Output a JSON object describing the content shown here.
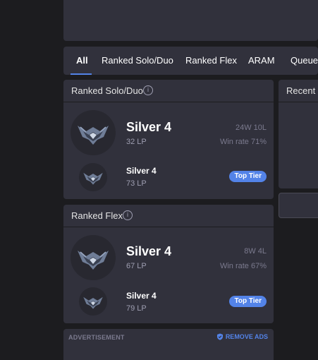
{
  "tabs": [
    {
      "label": "All",
      "active": true
    },
    {
      "label": "Ranked Solo/Duo",
      "active": false
    },
    {
      "label": "Ranked Flex",
      "active": false
    },
    {
      "label": "ARAM",
      "active": false
    },
    {
      "label": "Queue",
      "active": false
    }
  ],
  "solo": {
    "title": "Ranked Solo/Duo",
    "info_icon": "i",
    "current": {
      "tier": "Silver 4",
      "lp": "32 LP",
      "record": "24W 10L",
      "win_rate": "Win rate 71%"
    },
    "top": {
      "tier": "Silver 4",
      "lp": "73 LP",
      "badge": "Top Tier"
    }
  },
  "flex": {
    "title": "Ranked Flex",
    "info_icon": "i",
    "current": {
      "tier": "Silver 4",
      "lp": "67 LP",
      "record": "8W 4L",
      "win_rate": "Win rate 67%"
    },
    "top": {
      "tier": "Silver 4",
      "lp": "79 LP",
      "badge": "Top Tier"
    }
  },
  "recent": {
    "title": "Recent G"
  },
  "ad": {
    "label": "ADVERTISEMENT",
    "remove": "REMOVE ADS"
  },
  "icons": {
    "rank": "silver-emblem-icon",
    "info": "info-icon",
    "shield": "shield-icon"
  },
  "colors": {
    "background": "#1c1c1f",
    "panel": "#31313c",
    "accent": "#5383e8",
    "muted": "#9e9eb1"
  }
}
